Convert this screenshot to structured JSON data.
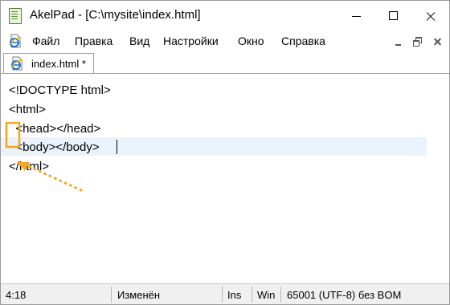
{
  "window": {
    "title": "AkelPad - [C:\\mysite\\index.html]",
    "icon": "notepad-icon"
  },
  "menu": {
    "items": [
      "Файл",
      "Правка",
      "Вид",
      "Настройки",
      "Окно",
      "Справка"
    ],
    "doc_icon": "ie-document-icon"
  },
  "tab": {
    "label": "index.html *",
    "icon": "ie-document-icon"
  },
  "editor": {
    "lines": [
      "<!DOCTYPE html>",
      "<html>",
      "  <head></head>",
      "  <body></body>",
      "</html>"
    ],
    "current_line": 4,
    "highlight_color": "#f5a623"
  },
  "status": {
    "position": "4:18",
    "modified": "Изменён",
    "insert_mode": "Ins",
    "newline": "Win",
    "encoding": "65001 (UTF-8) без BOM"
  }
}
